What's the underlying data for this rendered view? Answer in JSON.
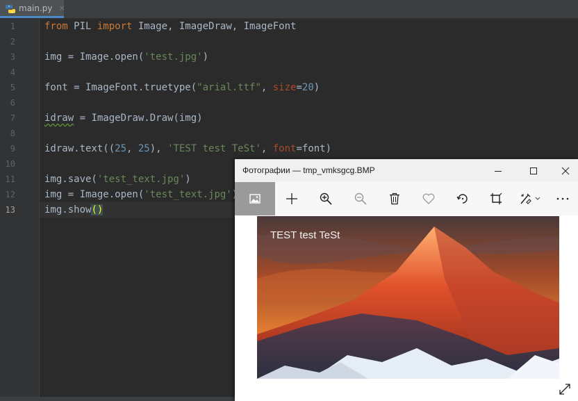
{
  "editor": {
    "tab": {
      "label": "main.py",
      "close": "×"
    },
    "line_numbers": [
      "1",
      "2",
      "3",
      "4",
      "5",
      "6",
      "7",
      "8",
      "9",
      "10",
      "11",
      "12",
      "13"
    ],
    "current_line": "13",
    "lines": [
      {
        "tokens": [
          {
            "t": "from",
            "c": "kw"
          },
          {
            "t": " PIL ",
            "c": ""
          },
          {
            "t": "import",
            "c": "kw"
          },
          {
            "t": " Image, ImageDraw, ImageFont",
            "c": ""
          }
        ]
      },
      {
        "tokens": []
      },
      {
        "tokens": [
          {
            "t": "img = Image.open(",
            "c": ""
          },
          {
            "t": "'test.jpg'",
            "c": "str"
          },
          {
            "t": ")",
            "c": ""
          }
        ]
      },
      {
        "tokens": []
      },
      {
        "tokens": [
          {
            "t": "font = ImageFont.truetype(",
            "c": ""
          },
          {
            "t": "\"arial.ttf\"",
            "c": "str"
          },
          {
            "t": ", ",
            "c": ""
          },
          {
            "t": "size",
            "c": "param"
          },
          {
            "t": "=",
            "c": ""
          },
          {
            "t": "20",
            "c": "num"
          },
          {
            "t": ")",
            "c": ""
          }
        ]
      },
      {
        "tokens": []
      },
      {
        "tokens": [
          {
            "t": "idraw",
            "c": "warn"
          },
          {
            "t": " = ImageDraw.Draw(img)",
            "c": ""
          }
        ]
      },
      {
        "tokens": []
      },
      {
        "tokens": [
          {
            "t": "idraw.text((",
            "c": ""
          },
          {
            "t": "25",
            "c": "num"
          },
          {
            "t": ", ",
            "c": ""
          },
          {
            "t": "25",
            "c": "num"
          },
          {
            "t": "), ",
            "c": ""
          },
          {
            "t": "'TEST test TeSt'",
            "c": "str"
          },
          {
            "t": ", ",
            "c": ""
          },
          {
            "t": "font",
            "c": "param"
          },
          {
            "t": "=font)",
            "c": ""
          }
        ]
      },
      {
        "tokens": []
      },
      {
        "tokens": [
          {
            "t": "img.save(",
            "c": ""
          },
          {
            "t": "'test_text.jpg'",
            "c": "str"
          },
          {
            "t": ")",
            "c": ""
          }
        ]
      },
      {
        "tokens": [
          {
            "t": "img = Image.open(",
            "c": ""
          },
          {
            "t": "'test_text.jpg'",
            "c": "str"
          },
          {
            "t": ")",
            "c": ""
          }
        ]
      },
      {
        "tokens": [
          {
            "t": "img.show",
            "c": ""
          },
          {
            "t": "()",
            "c": "brace-match"
          }
        ]
      }
    ]
  },
  "photos": {
    "title": "Фотографии — tmp_vmksgcg.BMP",
    "toolbar_icons": [
      "image-view-icon",
      "add-icon",
      "zoom-in-icon",
      "zoom-out-icon",
      "delete-icon",
      "favorite-icon",
      "rotate-icon",
      "crop-icon",
      "edit-icon",
      "more-icon"
    ],
    "image_text": "TEST test TeSt"
  }
}
